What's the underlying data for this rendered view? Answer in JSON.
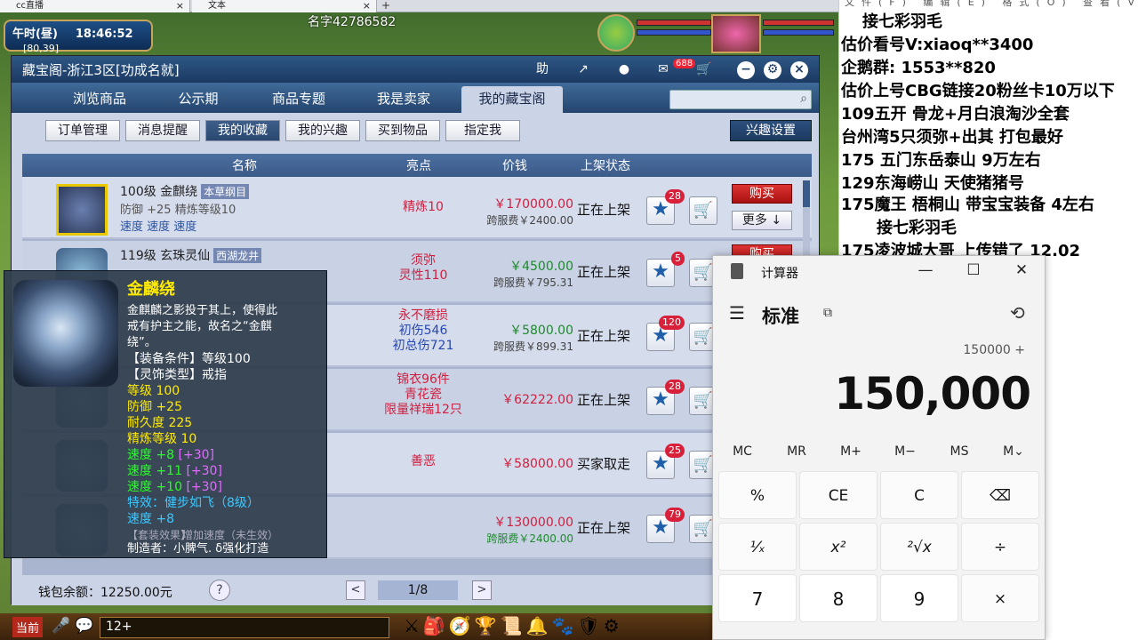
{
  "browser": {
    "tabs": [
      {
        "label": "cc直播",
        "close": "×"
      },
      {
        "label": "文本",
        "close": "×"
      }
    ],
    "new_tab": "+"
  },
  "game": {
    "time_period": "午时(昼)",
    "clock": "18:46:52",
    "location": "[80,39]",
    "character_name": "名字42786582",
    "chat_channel": "当前",
    "chat_input": "12+"
  },
  "cbg": {
    "title": "藏宝阁-浙江3区[功成名就]",
    "title_icons": {
      "assistant": "助",
      "share": "↗",
      "stop": "●",
      "message_badge": "688"
    },
    "nav": [
      "浏览商品",
      "公示期",
      "商品专题",
      "我是卖家",
      "我的藏宝阁"
    ],
    "subnav": [
      "订单管理",
      "消息提醒",
      "我的收藏",
      "我的兴趣",
      "买到物品",
      "指定我"
    ],
    "interest_settings": "兴趣设置",
    "columns": {
      "name": "名称",
      "highlight": "亮点",
      "price": "价钱",
      "status": "上架状态"
    },
    "buy_label": "购买",
    "more_label": "更多 ↓",
    "rows": [
      {
        "name": "100级 金麒绕",
        "tag": "本草纲目",
        "sub": "防御 +25 精炼等级10",
        "speed": "速度 速度 速度",
        "highlight": [
          "精炼10"
        ],
        "price": "￥170000.00",
        "fee": "跨服费￥2400.00",
        "status": "正在上架",
        "favs": "28"
      },
      {
        "name": "119级 玄珠灵仙",
        "tag": "西湖龙井",
        "sub": "",
        "speed": "",
        "highlight": [
          "须弥",
          "灵性110"
        ],
        "price": "￥4500.00",
        "fee": "跨服费￥795.31",
        "status": "正在上架",
        "favs": "5"
      },
      {
        "name": "",
        "tag": "",
        "sub": "",
        "speed": "",
        "highlight": [
          "永不磨损",
          "初伤546",
          "初总伤721"
        ],
        "price": "￥5800.00",
        "fee": "跨服费￥899.31",
        "status": "正在上架",
        "favs": "120"
      },
      {
        "name": "",
        "tag": "",
        "sub": "",
        "speed": "",
        "highlight": [
          "锦衣96件",
          "青花瓷",
          "限量祥瑞12只"
        ],
        "price": "￥62222.00",
        "fee": "",
        "status": "正在上架",
        "favs": "28"
      },
      {
        "name": "",
        "tag": "",
        "sub": "",
        "speed": "",
        "highlight": [
          "善恶"
        ],
        "price": "￥58000.00",
        "fee": "",
        "status": "买家取走",
        "favs": "25"
      },
      {
        "name": "",
        "tag": "",
        "sub": "",
        "speed": "",
        "highlight": [],
        "price": "￥130000.00",
        "fee": "跨服费￥2400.00",
        "status": "正在上架",
        "favs": "79"
      }
    ],
    "wallet": "钱包余额：12250.00元",
    "help": "?",
    "page": "1/8",
    "prev": "<",
    "next": ">"
  },
  "tooltip": {
    "title": "金麟绕",
    "desc1": "金麒麟之影投于其上，使得此",
    "desc2": "戒有护主之能，故名之“金麒",
    "desc3": "绕”。",
    "equip_req": "【装备条件】等级100",
    "type": "【灵饰类型】戒指",
    "level": "等级 100",
    "defense": "防御 +25",
    "durability": "耐久度 225",
    "refine": "精炼等级 10",
    "speed1": "速度 +8",
    "speed1b": "[+30]",
    "speed2": "速度 +11",
    "speed2b": "[+30]",
    "speed3": "速度 +10",
    "speed3b": "[+30]",
    "special": "特效：健步如飞（8级）",
    "speed4": "速度 +8",
    "set_effect": "【套装效果】",
    "set_speed": "增加速度（未生效）",
    "maker": "制造者：小脾气. δ强化打造"
  },
  "side_panel": {
    "menu": "文件(F) 编辑(E) 格式(O) 查看(V) 帮助(H)",
    "lines": [
      "接七彩羽毛",
      "估价看号V:xiaoq**3400",
      "企鹅群: 1553**820",
      "估价上号CBG链接20粉丝卡10万以下",
      "109五开 骨龙+月白浪淘沙全套",
      "台州湾5只须弥+出其 打包最好",
      "175 五门东岳泰山  9万左右",
      "129东海崂山 天使猪猪号",
      "175魔王 梧桐山  带宝宝装备 4左右",
      "接七彩羽毛",
      "175凌波城大哥 上传错了 12.02"
    ]
  },
  "calculator": {
    "title": "计算器",
    "mode": "标准",
    "expression": "150000 +",
    "display": "150,000",
    "window_buttons": [
      "—",
      "☐",
      "✕"
    ],
    "memory": [
      "MC",
      "MR",
      "M+",
      "M−",
      "MS",
      "M⌄"
    ],
    "keys": [
      "%",
      "CE",
      "C",
      "⌫",
      "¹⁄ₓ",
      "x²",
      "²√x",
      "÷",
      "7",
      "8",
      "9",
      "×"
    ]
  }
}
